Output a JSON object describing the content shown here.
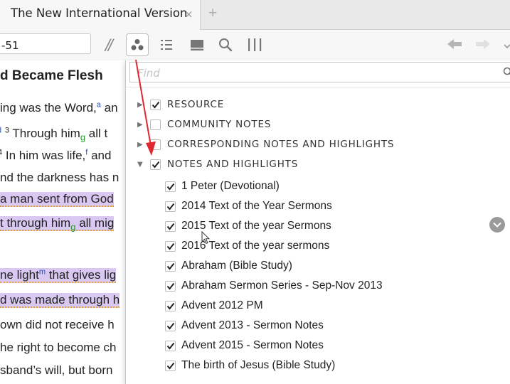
{
  "tab": {
    "title": "The New International Version",
    "close_glyph": "×",
    "add_glyph": "+"
  },
  "toolbar": {
    "reference_value": "-51",
    "parallel_glyph": "//",
    "icons": [
      "visual-filters-icon",
      "sections-icon",
      "panel-icon",
      "search-icon",
      "columns-icon",
      "back-arrow-icon",
      "forward-arrow-icon",
      "menu-caret-icon"
    ]
  },
  "bible": {
    "heading": "d Became Flesh",
    "lines": [
      {
        "before": "ing was the Word,",
        "sup": "a",
        "after": " an"
      },
      {
        "sup_d": "d",
        "vnum": "3",
        "text": "Through him",
        "tag": "g",
        "after": " all t"
      },
      {
        "vnum": "4",
        "text": "In him was life,",
        "sup": "f",
        "after": " and"
      },
      {
        "text": "nd the darkness has n"
      },
      {
        "text": "a man sent from God"
      },
      {
        "text": "t through him",
        "tag": "g",
        "after": " all mig"
      },
      {
        "text": "ne light",
        "sup": "m",
        "after": " that gives lig"
      },
      {
        "text": "d was made through h"
      },
      {
        "text": "own did not receive h"
      },
      {
        "text": "he right to become ch"
      },
      {
        "text": "sband’s will, but born"
      }
    ]
  },
  "filters": {
    "find_placeholder": "Find",
    "categories": [
      {
        "label": "RESOURCE",
        "expanded": false,
        "checked": true
      },
      {
        "label": "COMMUNITY NOTES",
        "expanded": false,
        "checked": false
      },
      {
        "label": "CORRESPONDING NOTES AND HIGHLIGHTS",
        "expanded": false,
        "checked": false
      },
      {
        "label": "NOTES AND HIGHLIGHTS",
        "expanded": true,
        "checked": true
      }
    ],
    "items": [
      "1 Peter (Devotional)",
      "2014 Text of the Year Sermons",
      "2015 Text of the year Sermons",
      "2016 Text of the year sermons",
      "Abraham (Bible Study)",
      "Abraham Sermon Series - Sep-Nov 2013",
      "Advent 2012 PM",
      "Advent 2013 - Sermon Notes",
      "Advent 2015 - Sermon Notes",
      "The birth of Jesus (Bible Study)"
    ]
  },
  "colors": {
    "highlight": "#d9c9f2",
    "squiggle": "#e3a325",
    "annotation_arrow": "#e0262f",
    "footnote": "#2a4bb3",
    "tag": "#2e9a2e"
  }
}
